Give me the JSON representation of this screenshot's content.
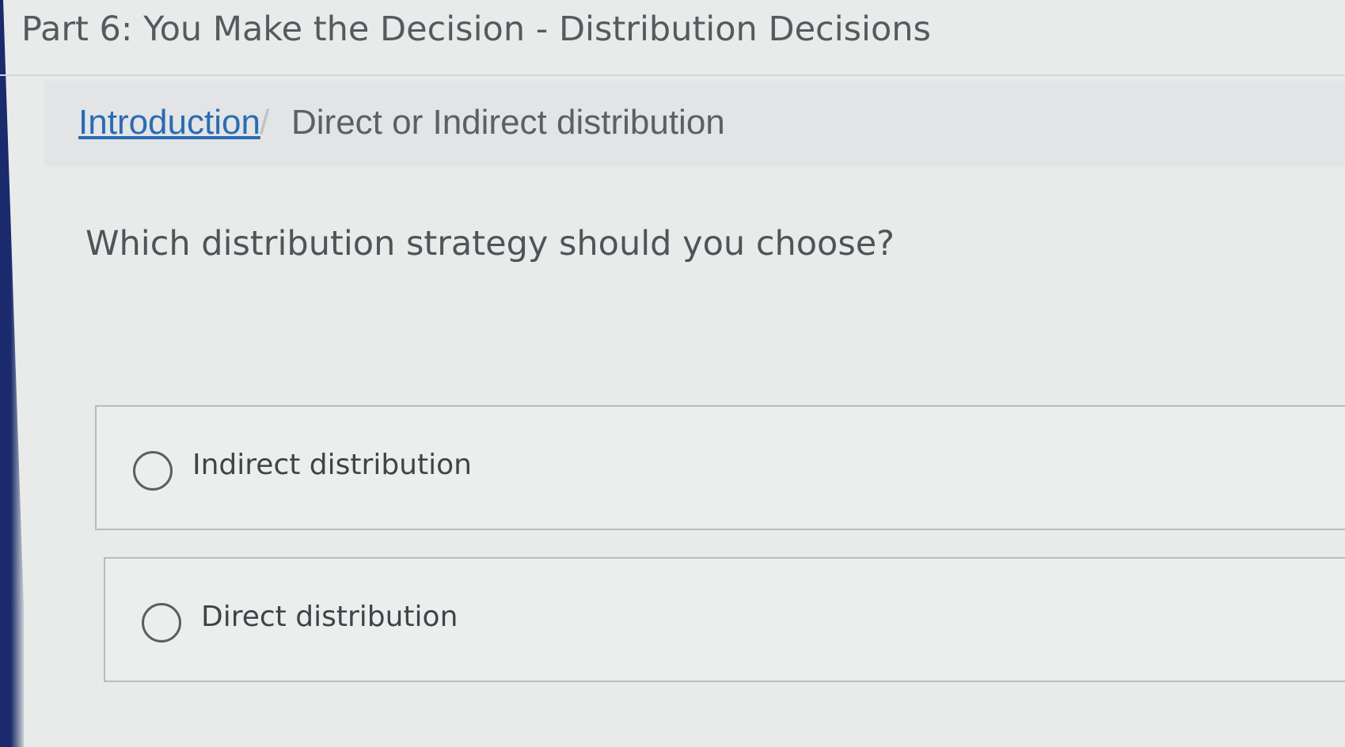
{
  "page_title": "Part 6: You Make the Decision - Distribution Decisions",
  "breadcrumb": {
    "link": "Introduction",
    "separator": "/",
    "current": "Direct or Indirect distribution"
  },
  "question": "Which distribution strategy should you choose?",
  "options": [
    {
      "label": "Indirect distribution"
    },
    {
      "label": "Direct distribution"
    }
  ],
  "colors": {
    "background": "#e9ebeb",
    "link": "#2a6bb5",
    "text": "#4f5458",
    "left_bar": "#1a2a6c"
  }
}
